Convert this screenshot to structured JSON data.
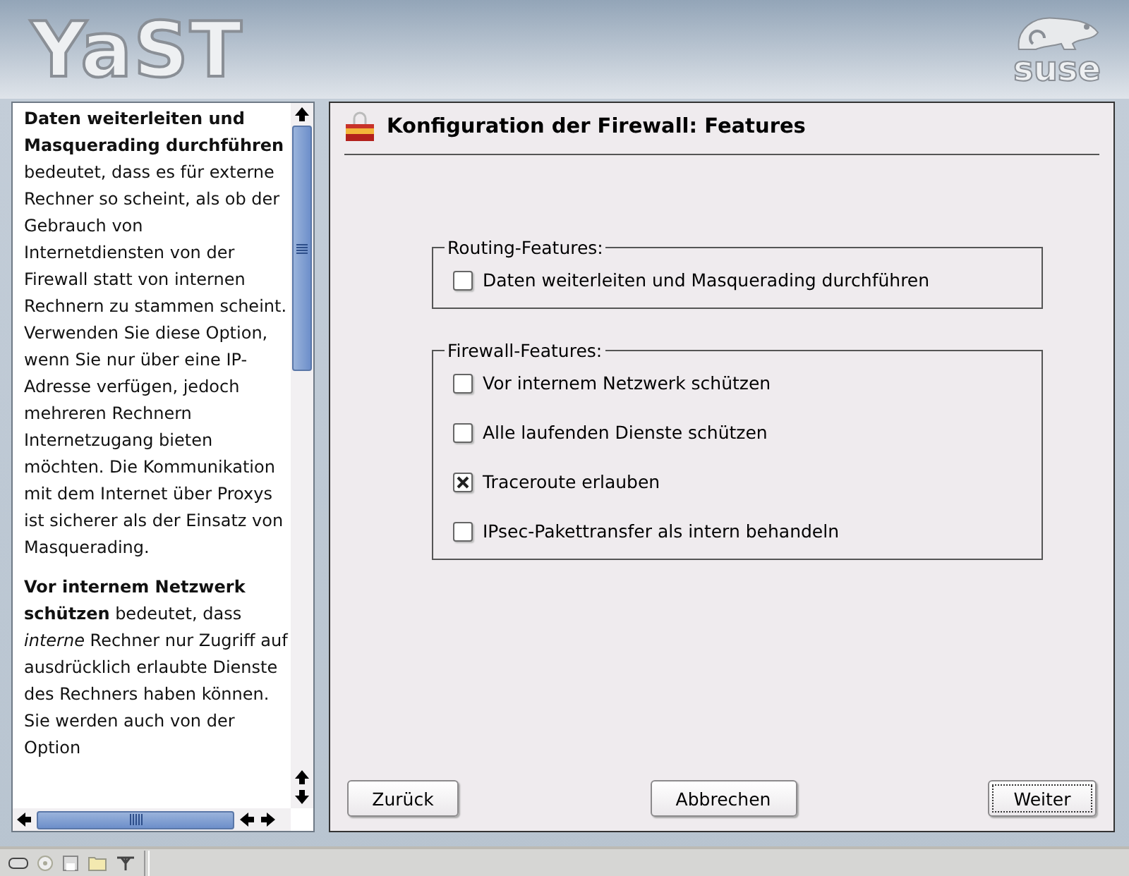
{
  "header": {
    "logo": "YaST",
    "brand": "suse"
  },
  "help": {
    "paragraphs": [
      "**Daten weiterleiten und Masquerading durchführen** bedeutet, dass es für externe Rechner so scheint, als ob der Gebrauch von Internetdiensten von der Firewall statt von internen Rechnern zu stammen scheint. Verwenden Sie diese Option, wenn Sie nur über eine IP-Adresse verfügen, jedoch mehreren Rechnern Internetzugang bieten möchten. Die Kommunikation mit dem Internet über Proxys ist sicherer als der Einsatz von Masquerading.",
      "**Vor internem Netzwerk schützen** bedeutet, dass *interne* Rechner nur Zugriff auf ausdrücklich erlaubte Dienste des Rechners haben können. Sie werden auch von der Option"
    ]
  },
  "dialog": {
    "title": "Konfiguration der Firewall: Features",
    "groups": [
      {
        "label": "Routing-Features:",
        "options": [
          {
            "label": "Daten weiterleiten und Masquerading durchführen",
            "checked": false
          }
        ]
      },
      {
        "label": "Firewall-Features:",
        "options": [
          {
            "label": "Vor internem Netzwerk schützen",
            "checked": false
          },
          {
            "label": "Alle laufenden Dienste schützen",
            "checked": false
          },
          {
            "label": "Traceroute erlauben",
            "checked": true
          },
          {
            "label": "IPsec-Pakettransfer als intern behandeln",
            "checked": false
          }
        ]
      }
    ],
    "buttons": [
      {
        "label": "Zurück",
        "selected": false
      },
      {
        "label": "Abbrechen",
        "selected": false
      },
      {
        "label": "Weiter",
        "selected": true
      }
    ]
  }
}
